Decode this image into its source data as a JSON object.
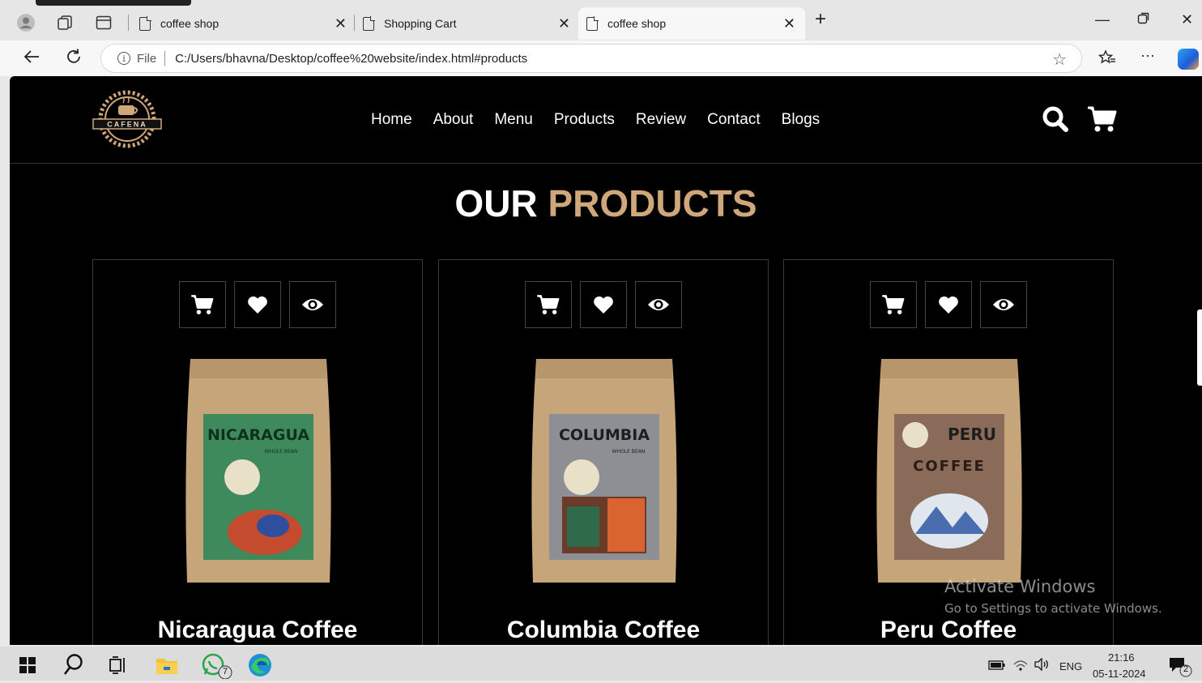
{
  "browser": {
    "tabs": [
      {
        "title": "coffee shop",
        "active": false
      },
      {
        "title": "Shopping Cart",
        "active": false
      },
      {
        "title": "coffee shop",
        "active": true
      }
    ],
    "url_scheme_label": "File",
    "url": "C:/Users/bhavna/Desktop/coffee%20website/index.html#products"
  },
  "site": {
    "logo_text": "CAFENA",
    "nav": [
      "Home",
      "About",
      "Menu",
      "Products",
      "Review",
      "Contact",
      "Blogs"
    ],
    "heading_main": "OUR",
    "heading_accent": "PRODUCTS",
    "accent_color": "#cfa77a",
    "products": [
      {
        "name": "Nicaragua Coffee",
        "bag_label": "NICARAGUA",
        "bag_color": "#3f8a5c",
        "bag_sub": "WHOLE BEAN"
      },
      {
        "name": "Columbia Coffee",
        "bag_label": "COLUMBIA",
        "bag_color": "#8d8f94",
        "bag_sub": "WHOLE BEAN"
      },
      {
        "name": "Peru Coffee",
        "bag_label": "PERU",
        "bag_color": "#8a6a58",
        "bag_sub": "COFFEE"
      }
    ]
  },
  "watermark": {
    "line1": "Activate Windows",
    "line2": "Go to Settings to activate Windows."
  },
  "taskbar": {
    "language": "ENG",
    "time": "21:16",
    "date": "05-11-2024",
    "whatsapp_badge": "7",
    "notif_badge": "2"
  }
}
